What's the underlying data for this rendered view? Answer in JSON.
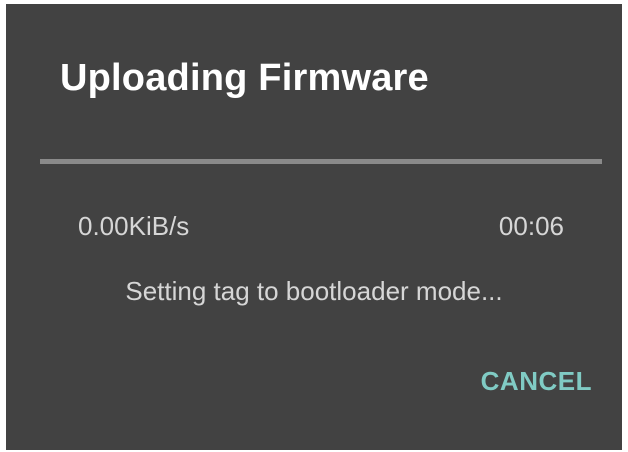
{
  "dialog": {
    "title": "Uploading Firmware",
    "progress": {
      "value_percent": 0,
      "track_color": "#8a8a8a",
      "fill_color": "#80cbc4"
    },
    "transfer_rate": "0.00KiB/s",
    "elapsed_time": "00:06",
    "status_message": "Setting tag to bootloader mode...",
    "cancel_label": "CANCEL",
    "colors": {
      "background": "#424242",
      "title": "#ffffff",
      "body_text": "#d6d6d6",
      "accent": "#80cbc4"
    }
  }
}
